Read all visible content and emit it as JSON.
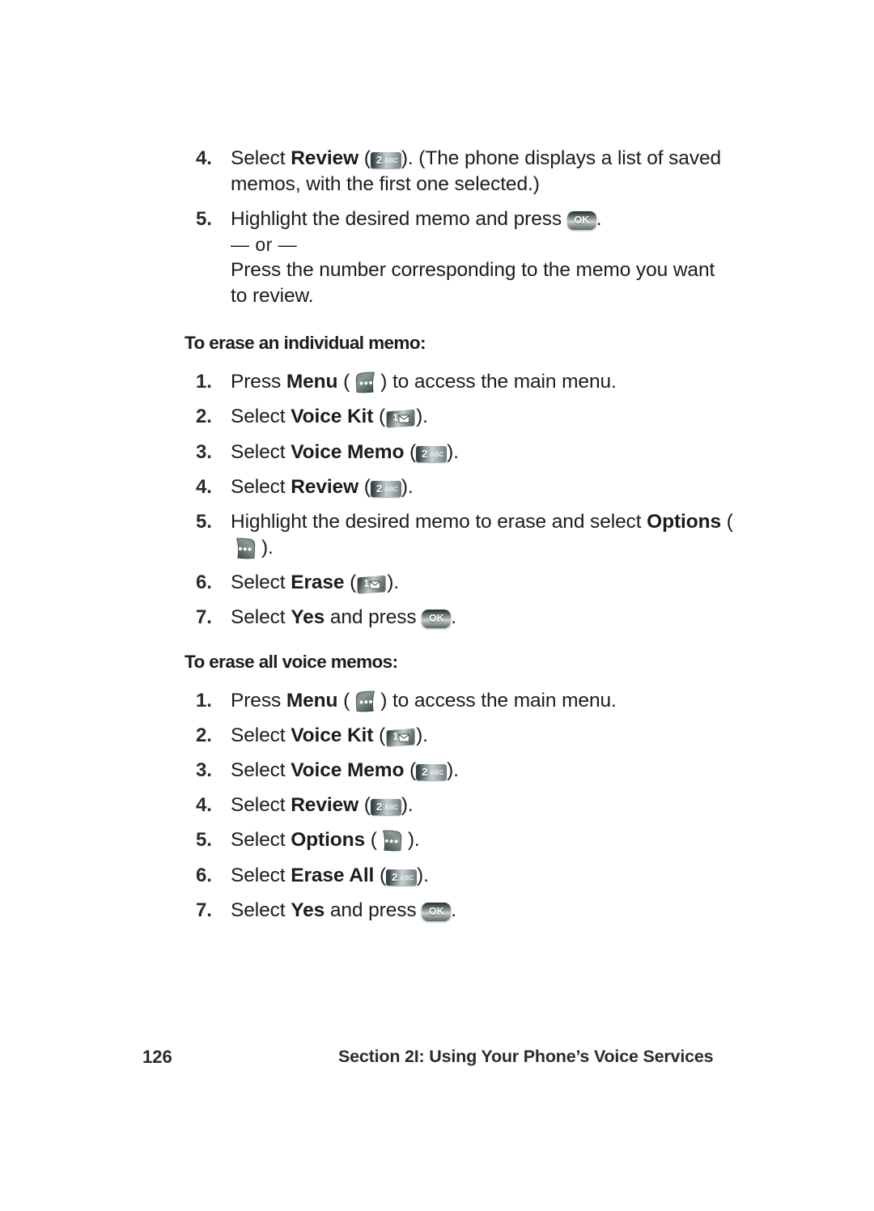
{
  "page": {
    "background_color": "#ffffff",
    "text_color": "#1c1c1c"
  },
  "icons": {
    "key_2abc": {
      "name": "key-2-abc-icon",
      "digit": "2",
      "letters": "ABC"
    },
    "key_1env": {
      "name": "key-1-envelope-icon",
      "digit": "1",
      "glyph": "envelope"
    },
    "key_ok": {
      "name": "key-ok-icon",
      "label": "OK"
    },
    "softkey_left": {
      "name": "softkey-menu-icon",
      "glyph": "three-dots"
    },
    "softkey_right": {
      "name": "softkey-options-icon",
      "glyph": "three-dots"
    }
  },
  "sections": [
    {
      "id": "review-continued",
      "heading": null,
      "steps": [
        {
          "num": "4.",
          "parts": [
            {
              "t": "Select "
            },
            {
              "t": "Review",
              "b": true
            },
            {
              "t": " ("
            },
            {
              "icon": "key_2abc"
            },
            {
              "t": "). (The phone displays a list of saved memos, with the first one selected.)"
            }
          ]
        },
        {
          "num": "5.",
          "parts": [
            {
              "t": "Highlight the desired memo and press "
            },
            {
              "icon": "key_ok"
            },
            {
              "t": "."
            }
          ],
          "extra_lines": [
            "— or —",
            "Press the number corresponding to the memo you want to review."
          ]
        }
      ]
    },
    {
      "id": "erase-individual",
      "heading": "To erase an individual memo:",
      "steps": [
        {
          "num": "1.",
          "parts": [
            {
              "t": "Press "
            },
            {
              "t": "Menu",
              "b": true
            },
            {
              "t": " ("
            },
            {
              "icon": "softkey_left"
            },
            {
              "t": ") to access the main menu."
            }
          ]
        },
        {
          "num": "2.",
          "parts": [
            {
              "t": "Select "
            },
            {
              "t": "Voice Kit",
              "b": true
            },
            {
              "t": " ("
            },
            {
              "icon": "key_1env"
            },
            {
              "t": ")."
            }
          ]
        },
        {
          "num": "3.",
          "parts": [
            {
              "t": "Select "
            },
            {
              "t": "Voice Memo",
              "b": true
            },
            {
              "t": " ("
            },
            {
              "icon": "key_2abc"
            },
            {
              "t": ")."
            }
          ]
        },
        {
          "num": "4.",
          "parts": [
            {
              "t": "Select "
            },
            {
              "t": "Review",
              "b": true
            },
            {
              "t": " ("
            },
            {
              "icon": "key_2abc"
            },
            {
              "t": ")."
            }
          ]
        },
        {
          "num": "5.",
          "parts": [
            {
              "t": "Highlight the desired memo to erase and select "
            },
            {
              "t": "Options",
              "b": true
            },
            {
              "t": " ("
            },
            {
              "icon": "softkey_right"
            },
            {
              "t": ")."
            }
          ]
        },
        {
          "num": "6.",
          "parts": [
            {
              "t": "Select "
            },
            {
              "t": "Erase",
              "b": true
            },
            {
              "t": " ("
            },
            {
              "icon": "key_1env"
            },
            {
              "t": ")."
            }
          ]
        },
        {
          "num": "7.",
          "parts": [
            {
              "t": "Select "
            },
            {
              "t": "Yes",
              "b": true
            },
            {
              "t": " and press "
            },
            {
              "icon": "key_ok"
            },
            {
              "t": "."
            }
          ]
        }
      ]
    },
    {
      "id": "erase-all",
      "heading": "To erase all voice memos:",
      "steps": [
        {
          "num": "1.",
          "parts": [
            {
              "t": "Press "
            },
            {
              "t": "Menu",
              "b": true
            },
            {
              "t": " ("
            },
            {
              "icon": "softkey_left"
            },
            {
              "t": ") to access the main menu."
            }
          ]
        },
        {
          "num": "2.",
          "parts": [
            {
              "t": "Select "
            },
            {
              "t": "Voice Kit",
              "b": true
            },
            {
              "t": " ("
            },
            {
              "icon": "key_1env"
            },
            {
              "t": ")."
            }
          ]
        },
        {
          "num": "3.",
          "parts": [
            {
              "t": "Select "
            },
            {
              "t": "Voice Memo",
              "b": true
            },
            {
              "t": " ("
            },
            {
              "icon": "key_2abc"
            },
            {
              "t": ")."
            }
          ]
        },
        {
          "num": "4.",
          "parts": [
            {
              "t": "Select "
            },
            {
              "t": "Review",
              "b": true
            },
            {
              "t": " ("
            },
            {
              "icon": "key_2abc"
            },
            {
              "t": ")."
            }
          ]
        },
        {
          "num": "5.",
          "parts": [
            {
              "t": "Select "
            },
            {
              "t": "Options",
              "b": true
            },
            {
              "t": " ("
            },
            {
              "icon": "softkey_right"
            },
            {
              "t": ")."
            }
          ]
        },
        {
          "num": "6.",
          "parts": [
            {
              "t": "Select "
            },
            {
              "t": "Erase All",
              "b": true
            },
            {
              "t": " ("
            },
            {
              "icon": "key_2abc"
            },
            {
              "t": ")."
            }
          ]
        },
        {
          "num": "7.",
          "parts": [
            {
              "t": "Select "
            },
            {
              "t": "Yes",
              "b": true
            },
            {
              "t": " and press "
            },
            {
              "icon": "key_ok"
            },
            {
              "t": "."
            }
          ]
        }
      ]
    }
  ],
  "footer": {
    "page_number": "126",
    "section_title": "Section 2I: Using Your Phone’s Voice Services"
  }
}
